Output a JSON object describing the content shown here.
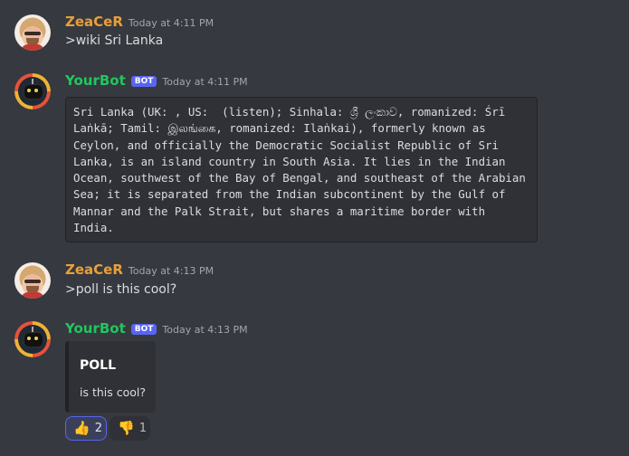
{
  "messages": [
    {
      "username": "ZeaCeR",
      "timestamp": "Today at 4:11 PM",
      "text": ">wiki Sri Lanka"
    },
    {
      "username": "YourBot",
      "badge": "BOT",
      "timestamp": "Today at 4:11 PM",
      "code": "Sri Lanka (UK: , US:  (listen); Sinhala: ශ්‍රී ලංකාව, romanized: Śrī Laṅkā; Tamil: இலங்கை, romanized: Ilaṅkai), formerly known as Ceylon, and officially the Democratic Socialist Republic of Sri Lanka, is an island country in South Asia. It lies in the Indian Ocean, southwest of the Bay of Bengal, and southeast of the Arabian Sea; it is separated from the Indian subcontinent by the Gulf of Mannar and the Palk Strait, but shares a maritime border with India."
    },
    {
      "username": "ZeaCeR",
      "timestamp": "Today at 4:13 PM",
      "text": ">poll is this cool?"
    },
    {
      "username": "YourBot",
      "badge": "BOT",
      "timestamp": "Today at 4:13 PM",
      "embed": {
        "title": "POLL",
        "description": "is this cool?"
      },
      "reactions": [
        {
          "emoji": "👍",
          "icon": "thumbs-up-icon",
          "count": "2",
          "active": true
        },
        {
          "emoji": "👎",
          "icon": "thumbs-down-icon",
          "count": "1",
          "active": false
        }
      ]
    }
  ],
  "colors": {
    "background": "#36393f",
    "user_name": "#e8a03a",
    "bot_name": "#22c55e",
    "bot_badge": "#5865f2"
  }
}
